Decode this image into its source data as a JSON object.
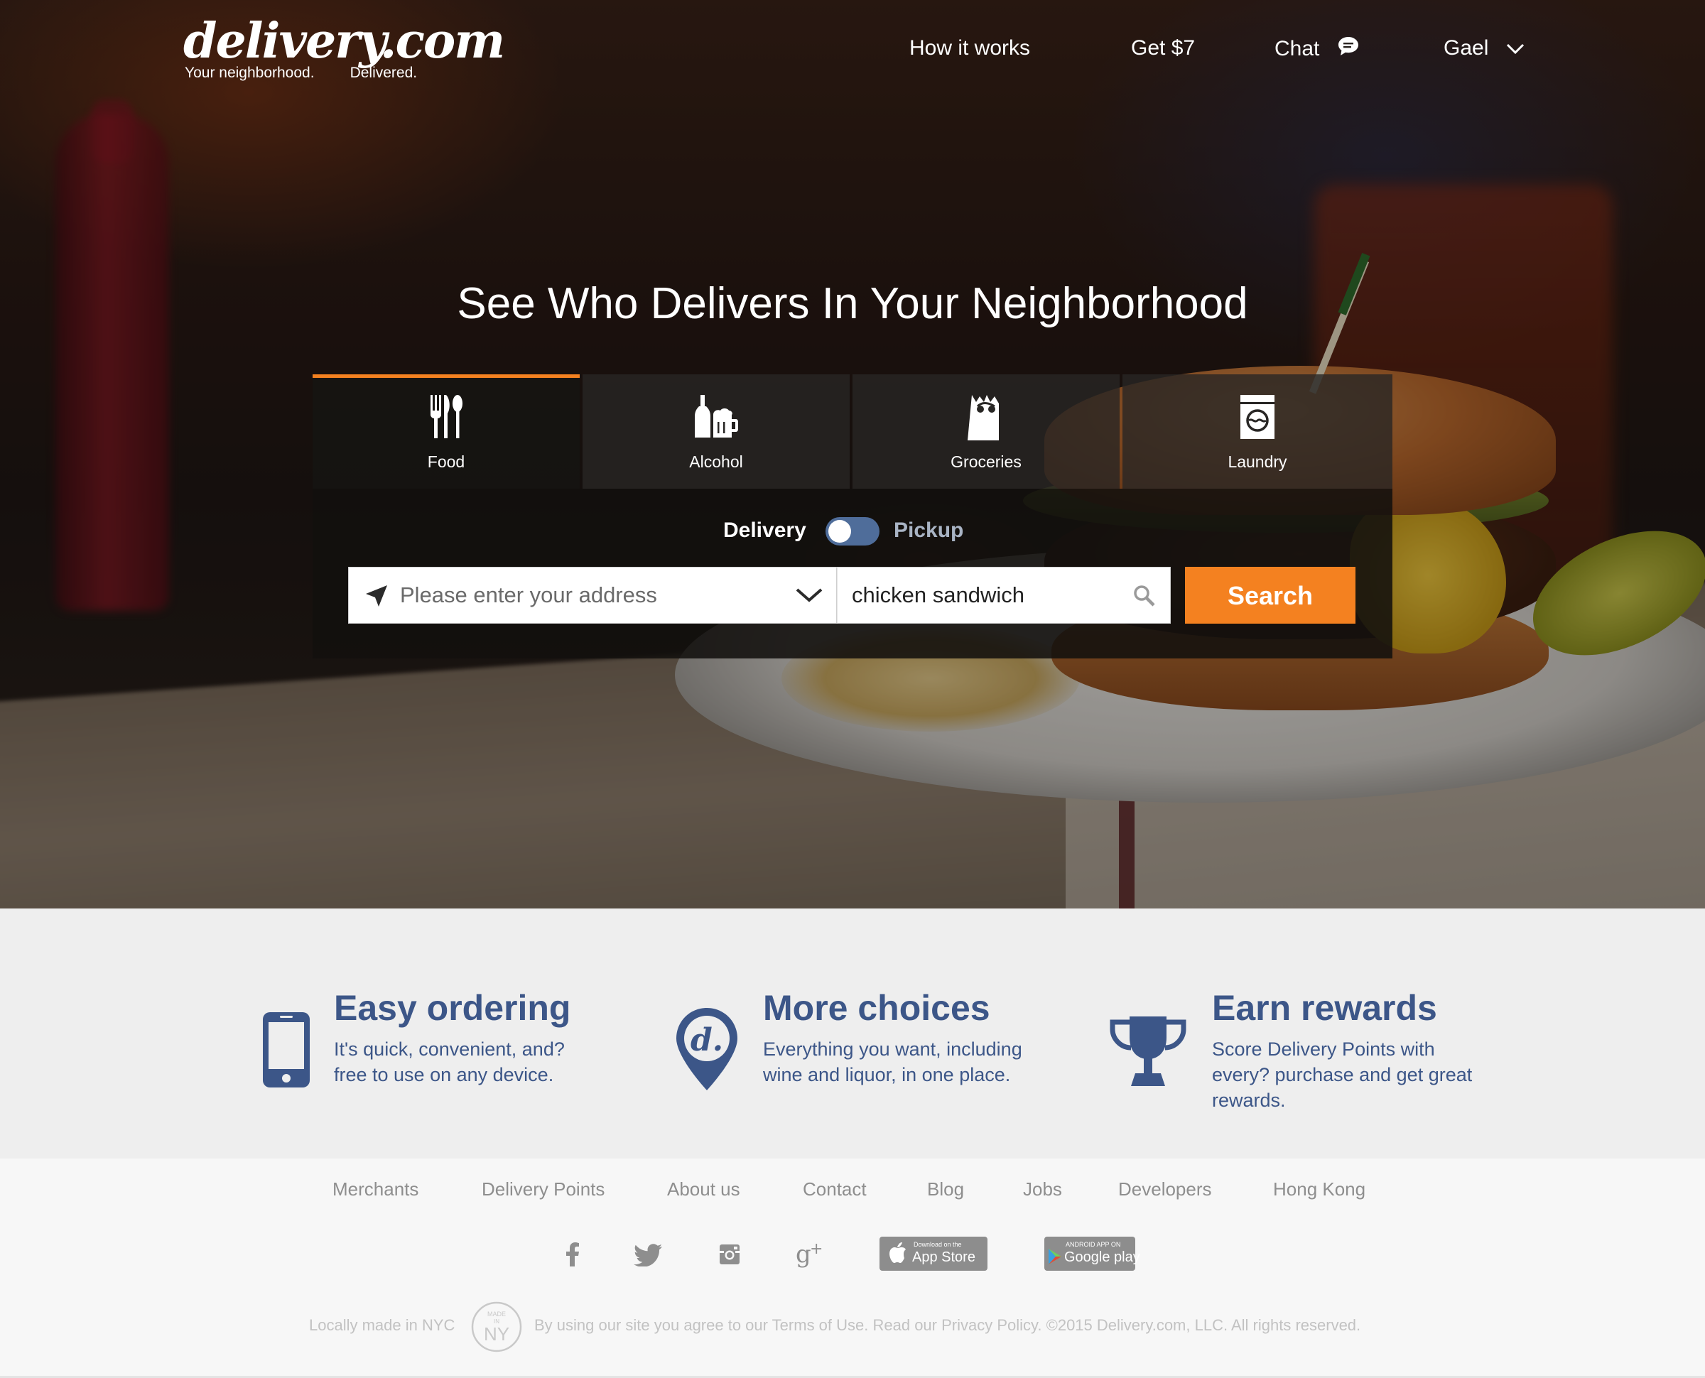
{
  "brand": {
    "name": "delivery.com",
    "tagline_left": "Your neighborhood.",
    "tagline_right": "Delivered."
  },
  "nav": {
    "how_it_works": "How it works",
    "get_credit": "Get $7",
    "chat": "Chat",
    "user": "Gael"
  },
  "hero": {
    "title": "See Who Delivers In Your Neighborhood"
  },
  "tabs": [
    {
      "label": "Food",
      "icon": "fork-knife-spoon-icon",
      "active": true
    },
    {
      "label": "Alcohol",
      "icon": "bottle-mug-icon",
      "active": false
    },
    {
      "label": "Groceries",
      "icon": "grocery-bag-icon",
      "active": false
    },
    {
      "label": "Laundry",
      "icon": "washing-machine-icon",
      "active": false
    }
  ],
  "mode": {
    "delivery": "Delivery",
    "pickup": "Pickup",
    "selected": "Delivery"
  },
  "search": {
    "address_placeholder": "Please enter your address",
    "query_value": "chicken sandwich",
    "button": "Search"
  },
  "features": [
    {
      "title": "Easy ordering",
      "desc": "It's quick, convenient, and? free to use on any device.",
      "icon": "phone-icon"
    },
    {
      "title": "More choices",
      "desc": "Everything you want, including wine and liquor, in one place.",
      "icon": "map-pin-d-icon"
    },
    {
      "title": "Earn rewards",
      "desc": "Score Delivery Points with every? purchase and get great rewards.",
      "icon": "trophy-icon"
    }
  ],
  "footer": {
    "links": [
      "Merchants",
      "Delivery Points",
      "About us",
      "Contact",
      "Blog",
      "Jobs",
      "Developers",
      "Hong Kong"
    ],
    "app_store_small": "Download on the",
    "app_store_big": "App Store",
    "google_play_small": "ANDROID APP ON",
    "google_play_big": "Google play",
    "made_in": "Locally made in NYC",
    "badge_top": "MADE",
    "badge_mid": "IN",
    "badge_big": "NY",
    "legal": "By using our site you agree to our Terms of Use. Read our Privacy Policy. ©2015 Delivery.com, LLC. All rights reserved."
  },
  "colors": {
    "accent_orange": "#f48120",
    "brand_blue": "#3c5688",
    "toggle_blue": "#4f6d9a",
    "footer_text": "#8e8e8e"
  }
}
